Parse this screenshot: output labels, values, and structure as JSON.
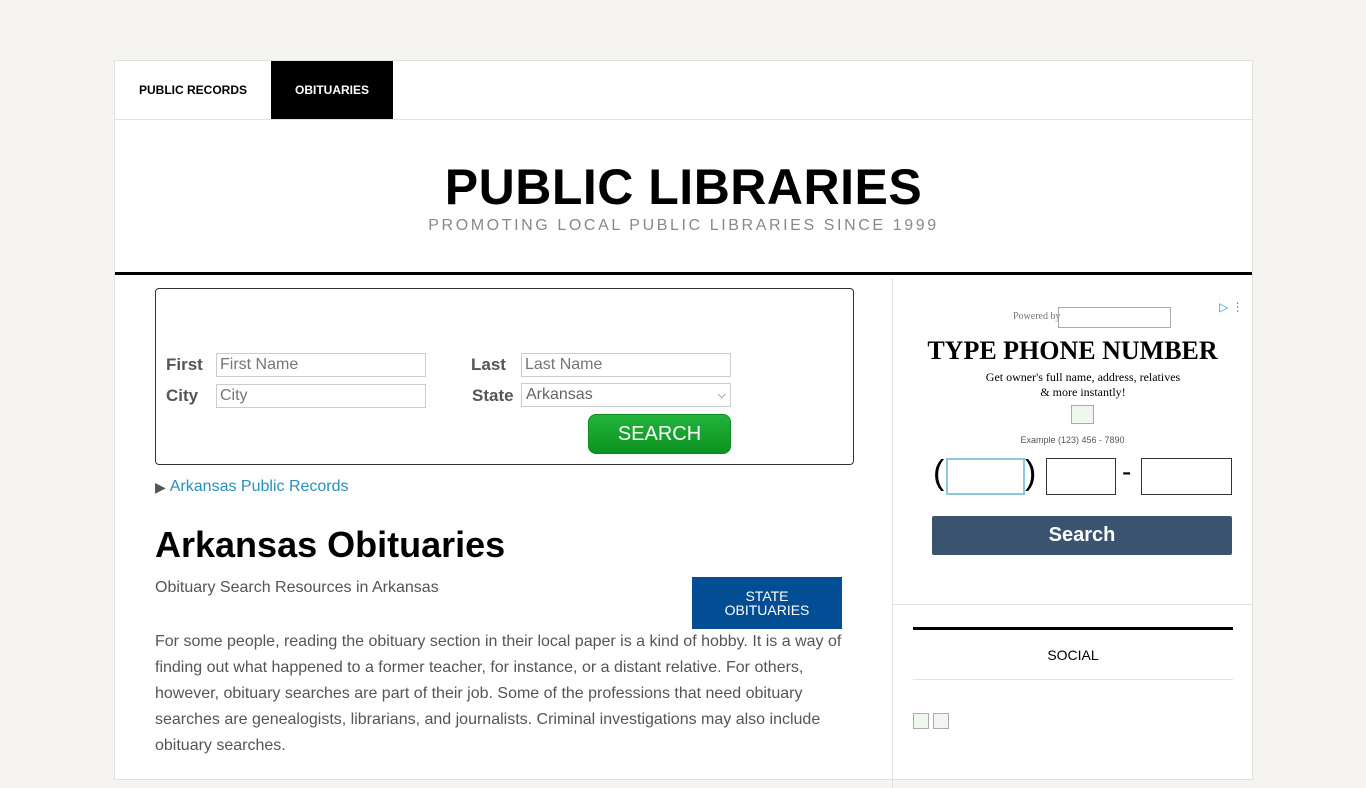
{
  "nav": {
    "items": [
      {
        "label": "PUBLIC RECORDS",
        "active": false
      },
      {
        "label": "OBITUARIES",
        "active": true
      }
    ]
  },
  "site": {
    "title": "PUBLIC LIBRARIES",
    "tagline": "PROMOTING LOCAL PUBLIC LIBRARIES SINCE 1999"
  },
  "search_form": {
    "first_label": "First",
    "first_placeholder": "First Name",
    "last_label": "Last",
    "last_placeholder": "Last Name",
    "city_label": "City",
    "city_placeholder": "City",
    "state_label": "State",
    "state_value": "Arkansas",
    "search_label": "SEARCH",
    "button_color": "#1aa830"
  },
  "records_link": "Arkansas Public Records",
  "article": {
    "heading": "Arkansas Obituaries",
    "subtitle": "Obituary Search Resources in Arkansas",
    "state_button": "STATE OBITUARIES",
    "state_button_color": "#034d95",
    "paragraph": "For some people, reading the obituary section in their local paper is a kind of hobby. It is a way of finding out what happened to a former teacher, for instance, or a distant relative. For others, however, obituary searches are part of their job. Some of the professions that need obituary searches are genealogists, librarians, and journalists. Criminal investigations may also include obituary searches."
  },
  "ad": {
    "powered_by": "Powered by",
    "title": "TYPE PHONE NUMBER",
    "desc_line1": "Get owner's full name, address, relatives",
    "desc_line2": "& more instantly!",
    "example": "Example (123) 456 - 7890",
    "open_paren": "(",
    "close_paren": ")",
    "dash": "-",
    "search_label": "Search",
    "search_color": "#3a5470"
  },
  "social": {
    "title": "SOCIAL"
  }
}
